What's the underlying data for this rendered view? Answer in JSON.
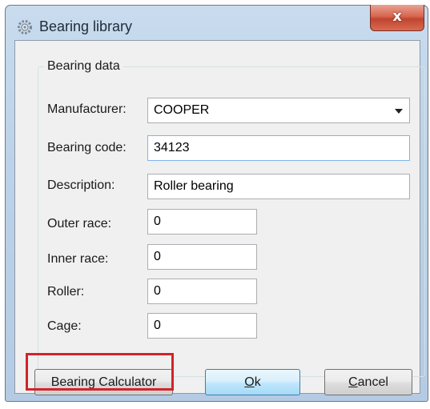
{
  "window": {
    "title": "Bearing library",
    "close_label": "x"
  },
  "group": {
    "label": "Bearing data"
  },
  "fields": {
    "manufacturer": {
      "label": "Manufacturer:",
      "value": "COOPER"
    },
    "bearing_code": {
      "label": "Bearing code:",
      "value": "34123"
    },
    "description": {
      "label": "Description:",
      "value": "Roller bearing"
    },
    "outer_race": {
      "label": "Outer race:",
      "value": "0"
    },
    "inner_race": {
      "label": "Inner race:",
      "value": "0"
    },
    "roller": {
      "label": "Roller:",
      "value": "0"
    },
    "cage": {
      "label": "Cage:",
      "value": "0"
    }
  },
  "buttons": {
    "calculator": "Bearing Calculator",
    "ok_mnemonic": "O",
    "ok_rest": "k",
    "cancel_mnemonic": "C",
    "cancel_rest": "ancel"
  },
  "colors": {
    "highlight": "#d2232a",
    "default_button": "#3c7fb1"
  },
  "icons": {
    "title": "bearing-gear-icon",
    "dropdown": "chevron-down-icon"
  }
}
